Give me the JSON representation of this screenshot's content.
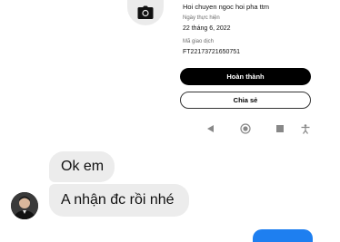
{
  "receipt": {
    "description": "Hoi chuyen ngoc hoi pha ttm",
    "date_label": "Ngày thực hiện",
    "date_value": "22 tháng 6, 2022",
    "code_label": "Mã giao dịch",
    "code_value": "FT22173721650751",
    "done_button": "Hoàn thành",
    "share_button": "Chia sẻ"
  },
  "nav_icons": [
    "back-icon",
    "home-icon",
    "recents-icon",
    "accessibility-icon"
  ],
  "chat": {
    "messages": [
      {
        "text": "Ok em"
      },
      {
        "text": "A nhận đc rồi nhé"
      }
    ]
  },
  "colors": {
    "bubble_incoming": "#ececec",
    "bubble_outgoing": "#1e7ff0",
    "primary_button": "#000000"
  }
}
